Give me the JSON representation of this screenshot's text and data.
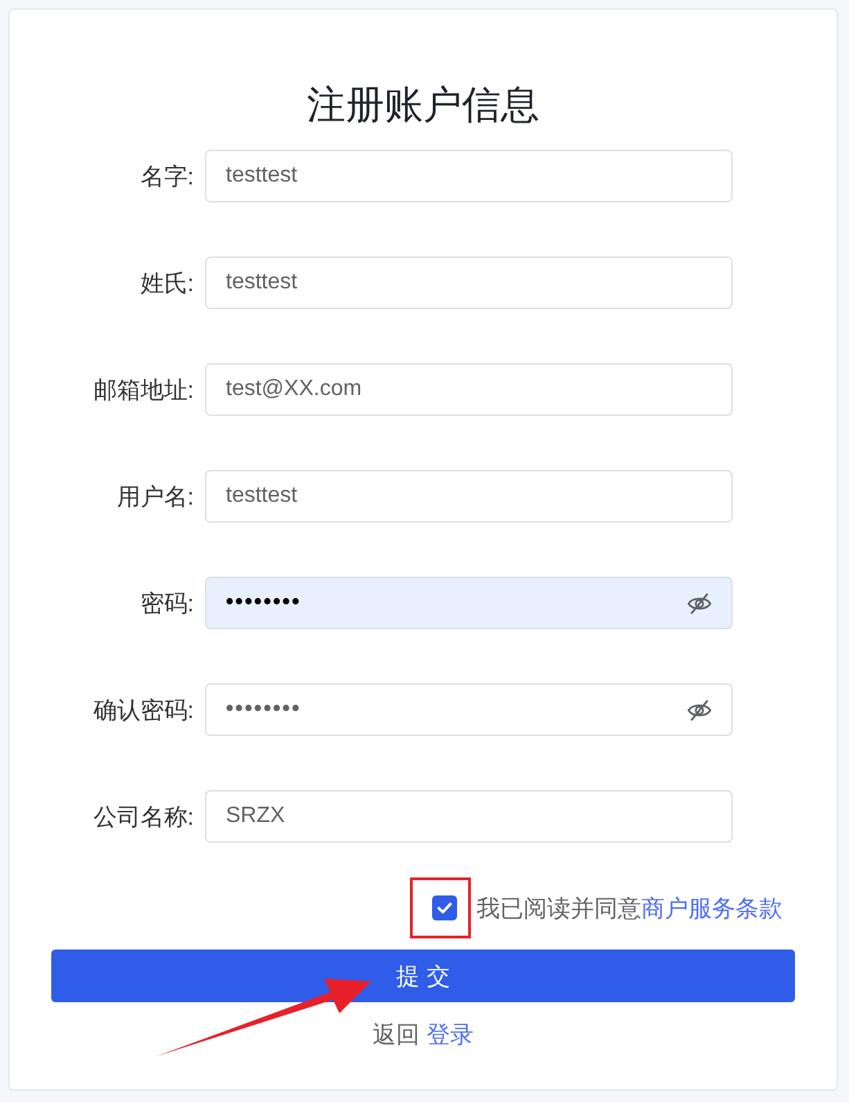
{
  "title": "注册账户信息",
  "fields": [
    {
      "label": "名字:",
      "kind": "text",
      "value": "testtest",
      "autofilled": false
    },
    {
      "label": "姓氏:",
      "kind": "text",
      "value": "testtest",
      "autofilled": false
    },
    {
      "label": "邮箱地址:",
      "kind": "text",
      "value": "test@XX.com",
      "autofilled": false
    },
    {
      "label": "用户名:",
      "kind": "text",
      "value": "testtest",
      "autofilled": false
    },
    {
      "label": "密码:",
      "kind": "password",
      "value": "••••••••",
      "autofilled": true
    },
    {
      "label": "确认密码:",
      "kind": "password",
      "value": "••••••••",
      "autofilled": false
    },
    {
      "label": "公司名称:",
      "kind": "text",
      "value": "SRZX",
      "autofilled": false
    }
  ],
  "agreement": {
    "checked": true,
    "text": "我已阅读并同意",
    "link": "商户服务条款"
  },
  "submit_button": "提 交",
  "footer": {
    "text": "返回",
    "link": "登录"
  }
}
